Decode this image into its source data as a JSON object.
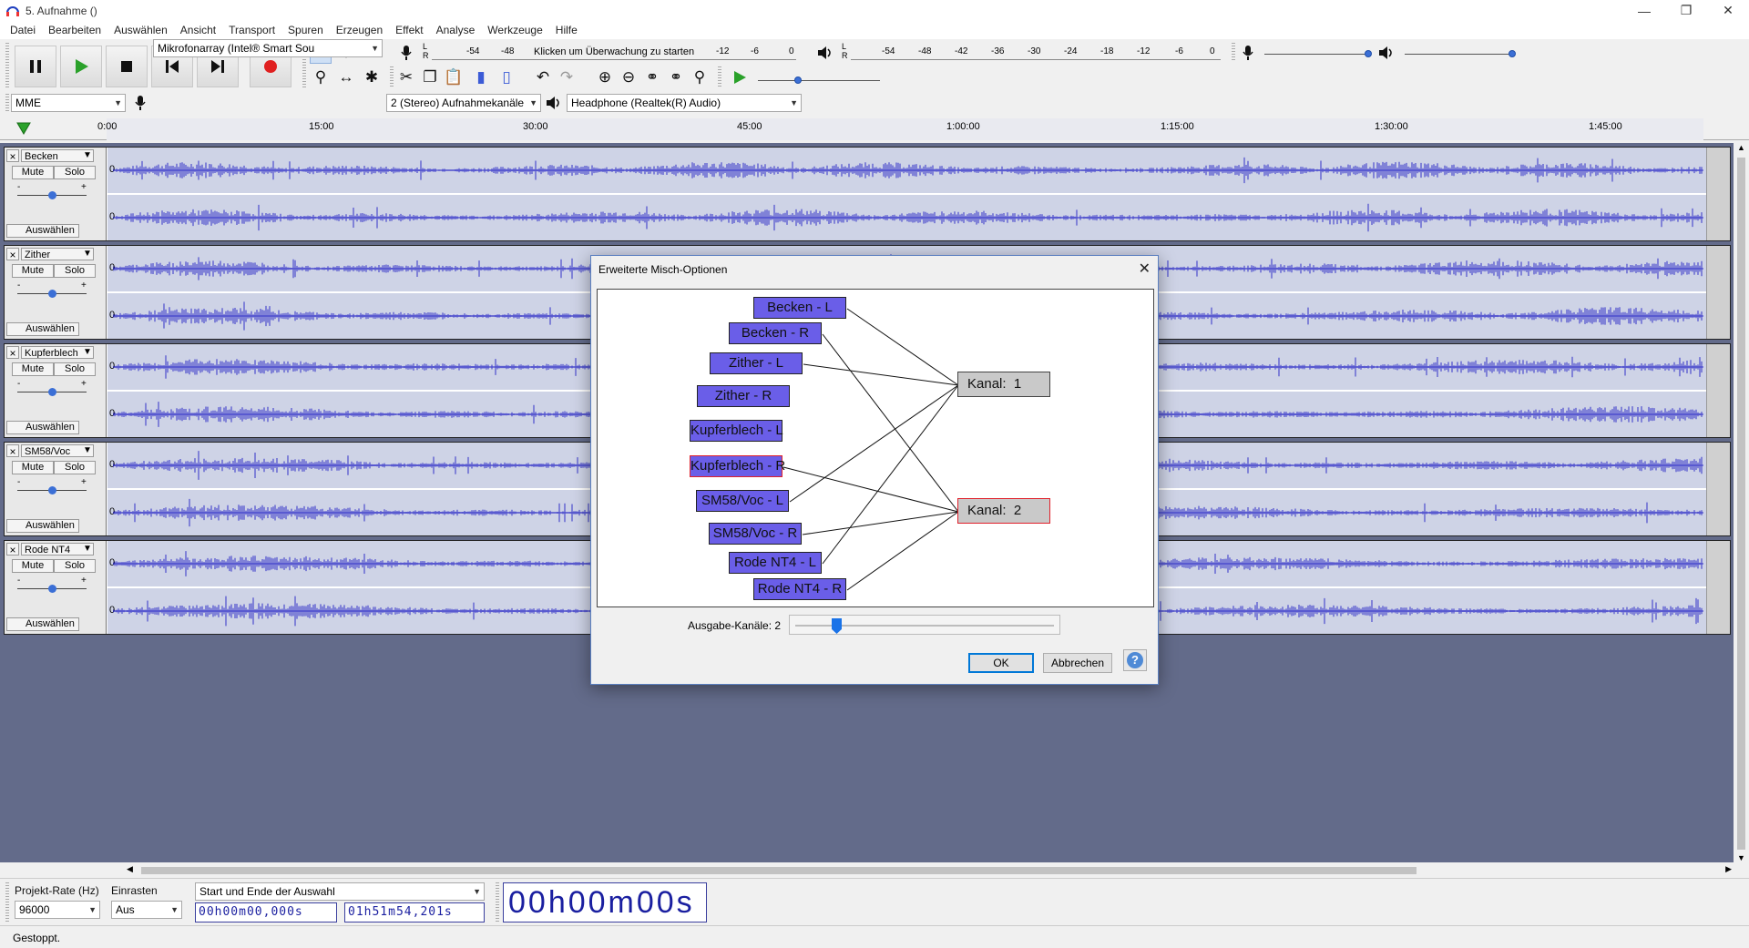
{
  "window": {
    "title": "5. Aufnahme ()"
  },
  "menu": [
    "Datei",
    "Bearbeiten",
    "Auswählen",
    "Ansicht",
    "Transport",
    "Spuren",
    "Erzeugen",
    "Effekt",
    "Analyse",
    "Werkzeuge",
    "Hilfe"
  ],
  "meters": {
    "record_scale": [
      "-54",
      "-48",
      "-12",
      "-6",
      "0"
    ],
    "record_hint": "Klicken um Überwachung zu starten",
    "playback_scale": [
      "-54",
      "-48",
      "-42",
      "-36",
      "-30",
      "-24",
      "-18",
      "-12",
      "-6",
      "0"
    ],
    "lr": [
      "L",
      "R"
    ]
  },
  "devices": {
    "host": "MME",
    "input": "Mikrofonarray (Intel® Smart Sou",
    "channels": "2 (Stereo) Aufnahmekanäle",
    "output": "Headphone (Realtek(R) Audio)"
  },
  "timeline": [
    "0:00",
    "15:00",
    "30:00",
    "45:00",
    "1:00:00",
    "1:15:00",
    "1:30:00",
    "1:45:00"
  ],
  "tracks": [
    {
      "name": "Becken"
    },
    {
      "name": "Zither"
    },
    {
      "name": "Kupferblech"
    },
    {
      "name": "SM58/Voc"
    },
    {
      "name": "Rode NT4"
    }
  ],
  "track_labels": {
    "mute": "Mute",
    "solo": "Solo",
    "select": "Auswählen",
    "zero": "0",
    "close": "×",
    "minus": "-",
    "plus": "+"
  },
  "dialog": {
    "title": "Erweiterte Misch-Optionen",
    "sources": [
      "Becken - L",
      "Becken - R",
      "Zither - L",
      "Zither - R",
      "Kupferblech - L",
      "Kupferblech - R",
      "SM58/Voc - L",
      "SM58/Voc - R",
      "Rode NT4 - L",
      "Rode NT4 - R"
    ],
    "selected_source": "Kupferblech - R",
    "channels": [
      "Kanal:  1",
      "Kanal:  2"
    ],
    "selected_channel": "Kanal:  2",
    "connections": {
      "Kanal:  1": [
        "Becken - L",
        "Zither - L",
        "SM58/Voc - L",
        "Rode NT4 - L"
      ],
      "Kanal:  2": [
        "Becken - R",
        "Kupferblech - R",
        "SM58/Voc - R",
        "Rode NT4 - R"
      ]
    },
    "output_label": "Ausgabe-Kanäle:  2",
    "output_channels": 2,
    "ok_label": "OK",
    "cancel_label": "Abbrechen",
    "help_label": "?"
  },
  "bottom": {
    "rate_label": "Projekt-Rate (Hz)",
    "rate_value": "96000",
    "snap_label": "Einrasten",
    "snap_value": "Aus",
    "selection_mode": "Start und Ende der Auswahl",
    "sel_start": "00h00m00,000s",
    "sel_end": "01h51m54,201s",
    "audio_position": "00h00m00s"
  },
  "status": {
    "text": "Gestoppt."
  },
  "colors": {
    "waveform": "#3232c8",
    "track_bg": "#ced3e6",
    "trackarea_bg": "#636b8a",
    "source_box": "#6a5ee8",
    "selected_border": "#e0202a"
  }
}
